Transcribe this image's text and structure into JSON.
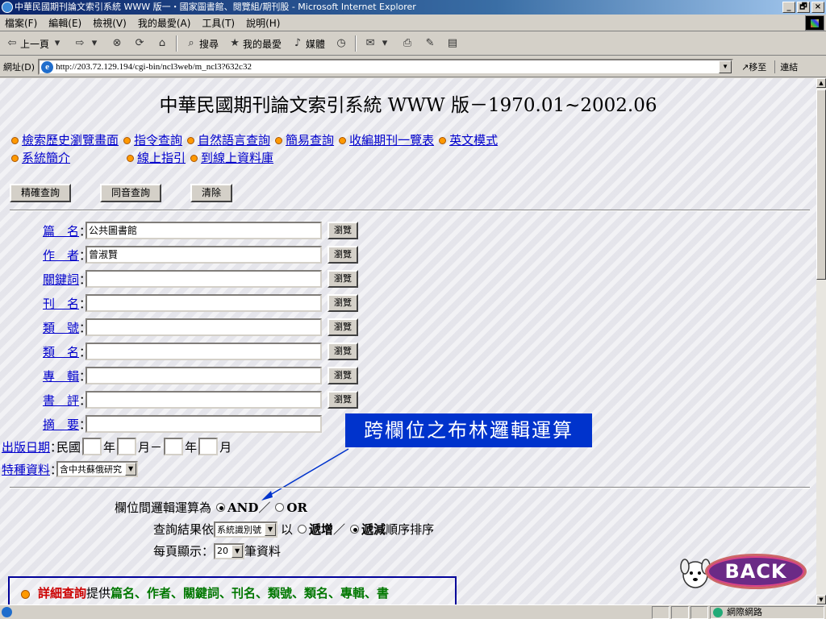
{
  "window": {
    "title": "中華民國期刊論文索引系統 WWW 版一・國家圖書館、閱覽組/期刊股 - Microsoft Internet Explorer",
    "buttons": [
      "_",
      "🗗",
      "×"
    ]
  },
  "menu": [
    "檔案(F)",
    "編輯(E)",
    "檢視(V)",
    "我的最愛(A)",
    "工具(T)",
    "說明(H)"
  ],
  "toolbar": {
    "back": "上一頁",
    "search": "搜尋",
    "favorites": "我的最愛",
    "media": "媒體"
  },
  "address": {
    "label": "網址(D)",
    "url": "http://203.72.129.194/cgi-bin/ncl3web/m_ncl3?632c32",
    "go": "移至",
    "links": "連結"
  },
  "page": {
    "title": "中華民國期刊論文索引系統 WWW 版－1970.01~2002.06",
    "nav_row1": [
      "檢索歷史瀏覽畫面",
      "指令查詢",
      "自然語言查詢",
      "簡易查詢",
      "收編期刊一覽表",
      "英文模式"
    ],
    "nav_row2": [
      "系統簡介",
      "線上指引",
      "到線上資料庫"
    ],
    "buttons": [
      "精確查詢",
      "同音查詢",
      "清除"
    ],
    "browse_label": "瀏覽",
    "fields": [
      {
        "label": "篇　名",
        "value": "公共圖書館"
      },
      {
        "label": "作　者",
        "value": "曾淑賢"
      },
      {
        "label": "關鍵詞",
        "value": ""
      },
      {
        "label": "刊　名",
        "value": ""
      },
      {
        "label": "類　號",
        "value": ""
      },
      {
        "label": "類　名",
        "value": ""
      },
      {
        "label": "專　輯",
        "value": ""
      },
      {
        "label": "書　評",
        "value": ""
      },
      {
        "label": "摘　要",
        "value": ""
      }
    ],
    "date": {
      "label": "出版日期",
      "era": "民國",
      "year1": "年",
      "month1": "月－",
      "year2": "年",
      "month2": "月"
    },
    "special": {
      "label": "特種資料",
      "value": "含中共蘇俄研究"
    },
    "callout": "跨欄位之布林邏輯運算",
    "logic": {
      "label": "欄位間邏輯運算為",
      "and": "AND",
      "sep": "／",
      "or": "OR"
    },
    "sort": {
      "prefix": "查詢結果依",
      "select": "系統識別號",
      "by": "以",
      "asc": "遞增",
      "sep": "／",
      "desc": "遞減",
      "suffix": "順序排序"
    },
    "perpage": {
      "prefix": "每頁顯示：",
      "value": "20",
      "suffix": "筆資料"
    },
    "back_button": "BACK",
    "info": {
      "red": "詳細查詢",
      "mid": "提供",
      "green": "篇名、作者、關鍵詞、刊名、類號、類名、專輯、書"
    }
  },
  "status": {
    "zone": "網際網路"
  }
}
